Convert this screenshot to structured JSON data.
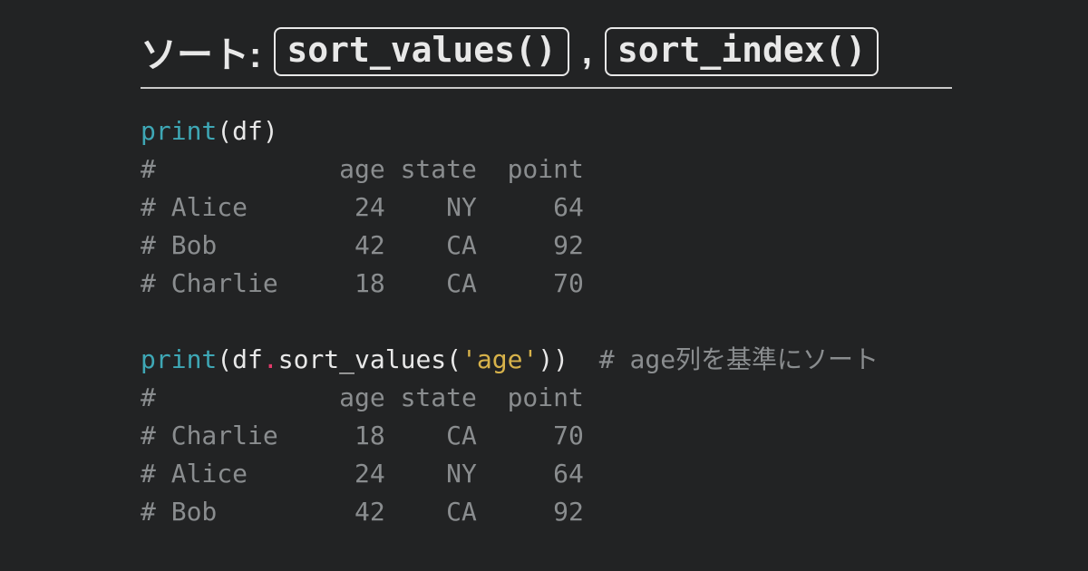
{
  "title": {
    "label": "ソート:",
    "chip1": "sort_values()",
    "sep": ",",
    "chip2": "sort_index()"
  },
  "code1": {
    "fn": "print",
    "lp": "(",
    "arg": "df",
    "rp": ")"
  },
  "out1": {
    "l0": "#            age state  point",
    "l1": "# Alice       24    NY     64",
    "l2": "# Bob         42    CA     92",
    "l3": "# Charlie     18    CA     70"
  },
  "code2": {
    "fn": "print",
    "lp": "(",
    "obj": "df",
    "dot": ".",
    "method": "sort_values",
    "lp2": "(",
    "argstr": "'age'",
    "rp2": "))",
    "trail_cmt": "  # age列を基準にソート"
  },
  "out2": {
    "l0": "#            age state  point",
    "l1": "# Charlie     18    CA     70",
    "l2": "# Alice       24    NY     64",
    "l3": "# Bob         42    CA     92"
  }
}
